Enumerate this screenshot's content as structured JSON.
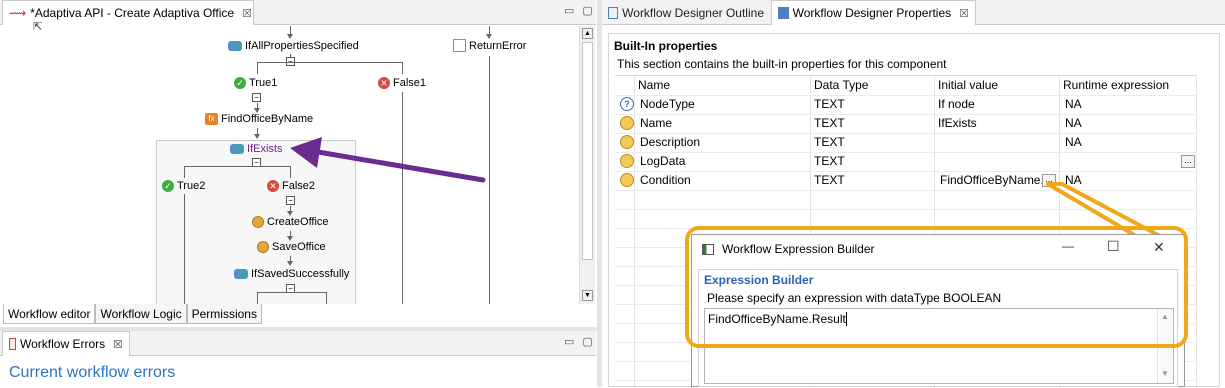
{
  "editor": {
    "tab_title": "*Adaptiva API - Create Adaptiva Office",
    "tab_close": "☒",
    "nodes": {
      "if_all": "IfAllPropertiesSpecified",
      "return_error": "ReturnError",
      "true1": "True1",
      "false1": "False1",
      "find_office": "FindOfficeByName",
      "if_exists": "IfExists",
      "true2": "True2",
      "false2": "False2",
      "create_office": "CreateOffice",
      "save_office": "SaveOffice",
      "if_saved": "IfSavedSuccessfully"
    },
    "bottom_tabs": [
      "Workflow editor",
      "Workflow Logic",
      "Permissions"
    ]
  },
  "errors_panel": {
    "tab_title": "Workflow Errors",
    "tab_close": "☒",
    "heading": "Current workflow errors"
  },
  "right_tabs": {
    "outline": "Workflow Designer Outline",
    "properties": "Workflow Designer Properties",
    "close": "☒"
  },
  "properties": {
    "section_title": "Built-In properties",
    "section_desc": "This section contains the built-in properties for this component",
    "columns": [
      "Name",
      "Data Type",
      "Initial value",
      "Runtime expression"
    ],
    "rows": [
      {
        "name": "NodeType",
        "type": "TEXT",
        "initial": "If node",
        "runtime": "NA"
      },
      {
        "name": "Name",
        "type": "TEXT",
        "initial": "IfExists",
        "runtime": "NA"
      },
      {
        "name": "Description",
        "type": "TEXT",
        "initial": "",
        "runtime": "NA"
      },
      {
        "name": "LogData",
        "type": "TEXT",
        "initial": "",
        "runtime": ""
      },
      {
        "name": "Condition",
        "type": "TEXT",
        "initial": "FindOfficeByName.",
        "runtime": "NA"
      }
    ],
    "ellipsis": "..."
  },
  "dialog": {
    "title": "Workflow Expression Builder",
    "minimize": "—",
    "maximize": "☐",
    "close": "✕",
    "section_title": "Expression Builder",
    "instruction": "Please specify an expression with dataType BOOLEAN",
    "expression": "FindOfficeByName.Result"
  },
  "annotation": {
    "arrow_color": "#6a2c91",
    "highlight_color": "#f0a818"
  }
}
